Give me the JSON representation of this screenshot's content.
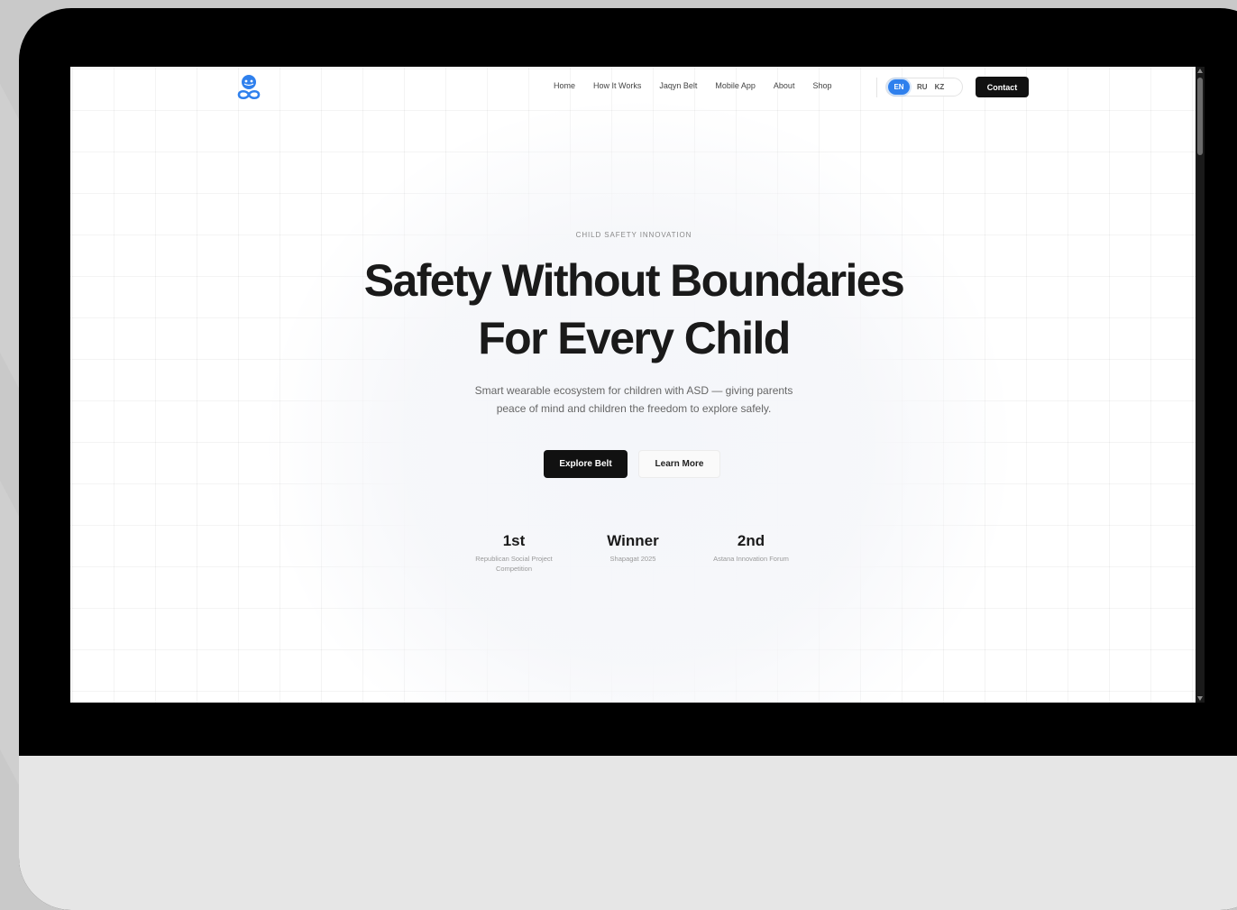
{
  "nav": {
    "links": [
      "Home",
      "How It Works",
      "Jaqyn Belt",
      "Mobile App",
      "About",
      "Shop"
    ],
    "languages": [
      "EN",
      "RU",
      "KZ"
    ],
    "active_language": "EN",
    "contact_label": "Contact"
  },
  "hero": {
    "eyebrow": "CHILD SAFETY INNOVATION",
    "headline_line1": "Safety Without Boundaries",
    "headline_line2": "For Every Child",
    "subtitle_line1": "Smart wearable ecosystem for children with ASD — giving parents",
    "subtitle_line2": "peace of mind and children the freedom to explore safely.",
    "primary_cta": "Explore Belt",
    "secondary_cta": "Learn More"
  },
  "stats": [
    {
      "value": "1st",
      "label_line1": "Republican Social Project",
      "label_line2": "Competition"
    },
    {
      "value": "Winner",
      "label_line1": "Shapagat 2025",
      "label_line2": ""
    },
    {
      "value": "2nd",
      "label_line1": "Astana Innovation Forum",
      "label_line2": ""
    }
  ],
  "colors": {
    "accent": "#2f80ed",
    "primary_button": "#111111",
    "bezel": "#000000",
    "chin": "#e6e6e6"
  },
  "icons": {
    "logo": "infinity-face-logo-icon"
  }
}
